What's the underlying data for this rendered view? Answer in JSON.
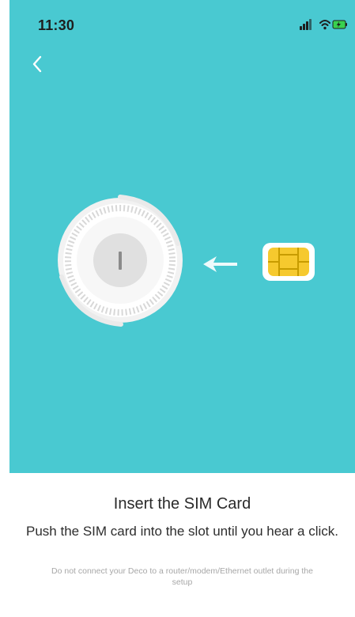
{
  "status_bar": {
    "time": "11:30",
    "icons": [
      "signal-icon",
      "wifi-icon",
      "battery-charging-icon"
    ]
  },
  "navigation": {
    "back_icon": "chevron-left-icon"
  },
  "illustration": {
    "background_color": "#49c9d1",
    "device_icon": "deco-device-icon",
    "arrow_icon": "arrow-left-icon",
    "sim_icon": "sim-card-icon",
    "sim_color": "#f6c92e"
  },
  "content": {
    "title": "Insert the SIM Card",
    "subtitle": "Push the SIM card into the slot until you hear a click.",
    "note": "Do not connect your Deco to a router/modem/Ethernet outlet during the setup"
  }
}
